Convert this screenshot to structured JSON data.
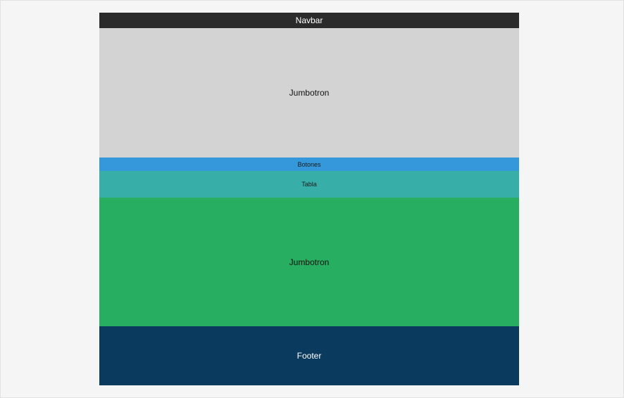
{
  "sections": {
    "navbar": {
      "label": "Navbar",
      "color": "#2b2b2b"
    },
    "jumbotron_top": {
      "label": "Jumbotron",
      "color": "#d3d3d3"
    },
    "botones": {
      "label": "Botones",
      "color": "#3498db"
    },
    "tabla": {
      "label": "Tabla",
      "color": "#38aea9"
    },
    "jumbotron_bottom": {
      "label": "Jumbotron",
      "color": "#27ae60"
    },
    "footer": {
      "label": "Footer",
      "color": "#0b3a5f"
    }
  }
}
